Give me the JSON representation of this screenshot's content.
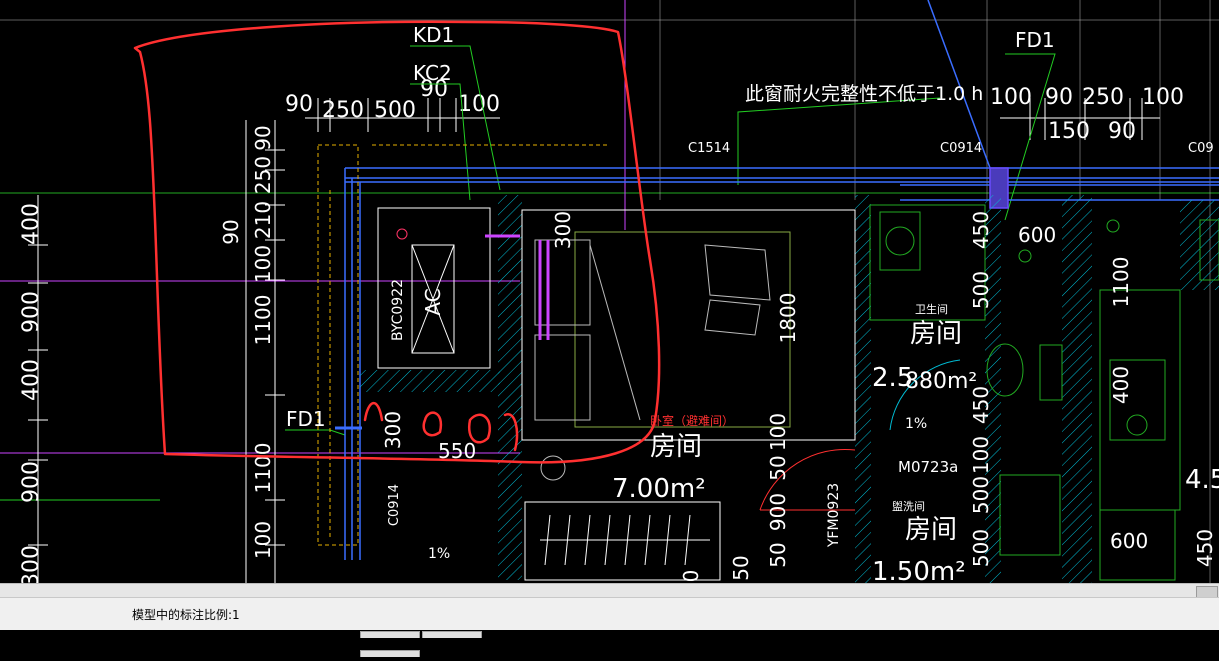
{
  "drawing": {
    "labels": {
      "kd1": "KD1",
      "kc2": "KC2",
      "fd1_top": "FD1",
      "fd1_left": "FD1",
      "fire_note": "此窗耐火完整性不低于1.0 h",
      "c1514": "C1514",
      "c0914_top": "C0914",
      "c09_edge": "C09",
      "c0914_left": "C0914",
      "byc0922": "BYC0922",
      "ac": "AC",
      "yfm0923": "YFM0923",
      "m0723a": "M0723a",
      "bedroom_tag": "卧室（避难间）",
      "bath_tag": "卫生间",
      "wash_tag": "盥洗间",
      "room_main": "房间",
      "room_bath": "房间",
      "room_wash": "房间",
      "area_main": "7.00m²",
      "area_bath_a": "2.5",
      "area_bath_b": "880m²",
      "area_wash": "1.50m²",
      "slope_a": "1%",
      "slope_b": "1%",
      "edge_45": "4.5"
    },
    "top_dims": {
      "d90a": "90",
      "d250": "250",
      "d500": "500",
      "d90b": "90",
      "d100": "100",
      "r100a": "100",
      "r90a": "90",
      "r250": "250",
      "r100b": "100",
      "r150": "150",
      "r90b": "90"
    },
    "left_dims": {
      "l400a": "400",
      "l900a": "900",
      "l400b": "400",
      "l900b": "900",
      "l300": "300",
      "s90": "90",
      "s250": "250",
      "s210": "210",
      "s90b": "90",
      "s100a": "100",
      "s1100a": "1100",
      "s1100b": "1100",
      "s100b": "100"
    },
    "inner_dims": {
      "i300": "300",
      "i1800": "1800",
      "i300b": "300",
      "i550": "550",
      "i100a": "100",
      "i50a": "50",
      "i900": "900",
      "i50b": "50",
      "i50c": "50",
      "i0": "0",
      "i450a": "450",
      "i600a": "600",
      "i500a": "500",
      "i1100": "1100",
      "i450b": "450",
      "i400": "400",
      "i100b": "100",
      "i500b": "500",
      "i500c": "500",
      "i600b": "600",
      "i450c": "450"
    }
  },
  "status_bar": {
    "text": "模型中的标注比例:1"
  },
  "colors": {
    "background": "#000000",
    "wall_blue": "#3a6dff",
    "dimension_white": "#ffffff",
    "markup_red": "#ff3030",
    "leader_green": "#22cc22",
    "magenta": "#cc44ff",
    "hatch_cyan": "#00bcd4"
  }
}
